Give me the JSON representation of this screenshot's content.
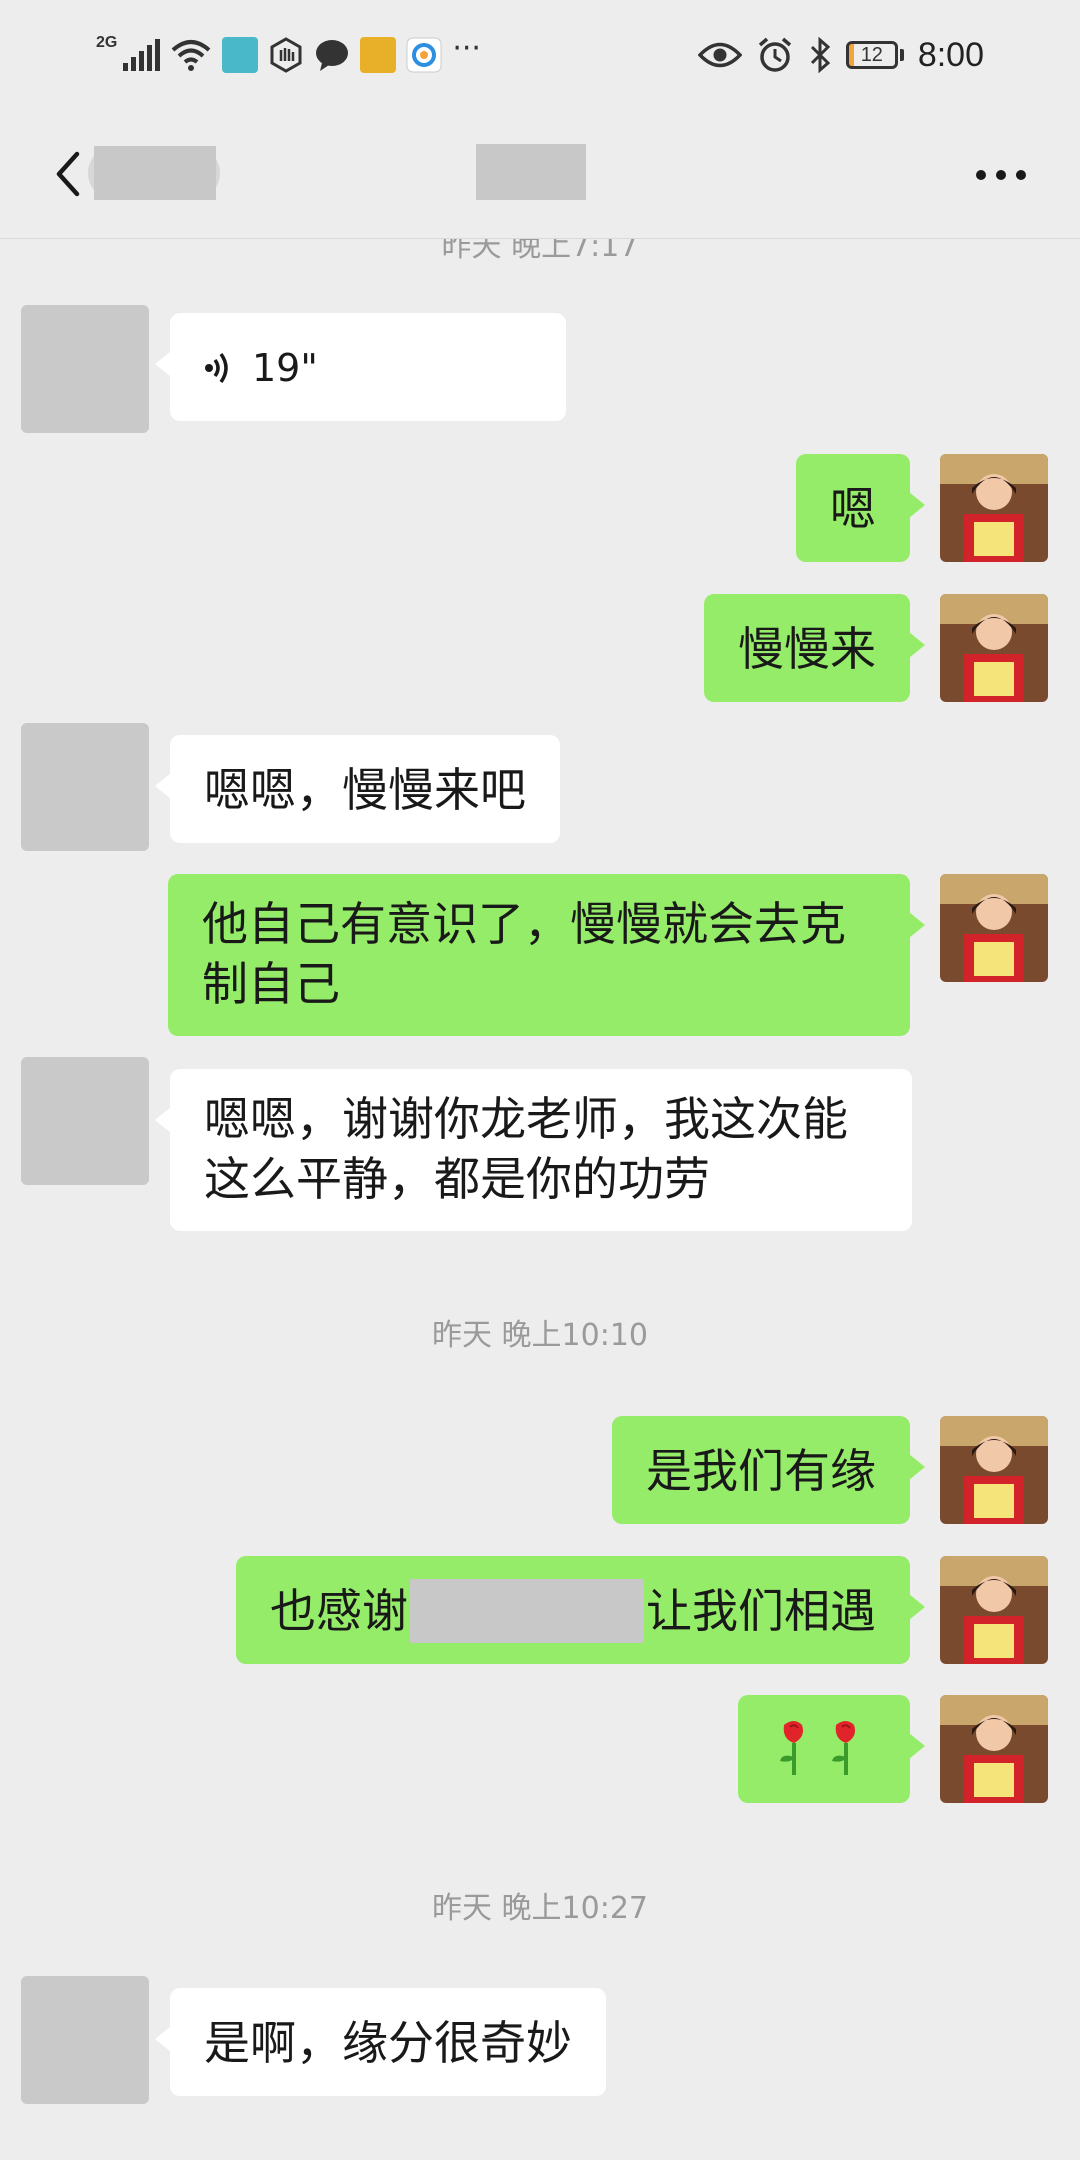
{
  "status_bar": {
    "network": "2G",
    "more": "···",
    "battery": "12",
    "battery_level": 0.12,
    "time": "8:00"
  },
  "header": {
    "more_icon": "more-icon",
    "back_icon": "chevron-left-icon"
  },
  "chat": {
    "clipped_timestamp": "昨天 晚上7:17",
    "messages": [
      {
        "voice_duration": "19\""
      },
      {
        "text": "嗯"
      },
      {
        "text": "慢慢来"
      },
      {
        "text": "嗯嗯，慢慢来吧"
      },
      {
        "text": "他自己有意识了，慢慢就会去克制自己"
      },
      {
        "text": "嗯嗯，谢谢你龙老师，我这次能这么平静，都是你的功劳"
      },
      {
        "text_before": "也感谢",
        "text_after": "让我们相遇"
      },
      {
        "text": "是我们有缘"
      },
      {
        "emoji": "🌹🌹"
      },
      {
        "text": "是啊，缘分很奇妙"
      }
    ],
    "timestamps": {
      "t1": "昨天 晚上10:10",
      "t2": "昨天 晚上10:27"
    }
  },
  "colors": {
    "background": "#ededed",
    "outgoing_bubble": "#95ec69",
    "incoming_bubble": "#ffffff",
    "redaction": "#c8c8c8"
  }
}
